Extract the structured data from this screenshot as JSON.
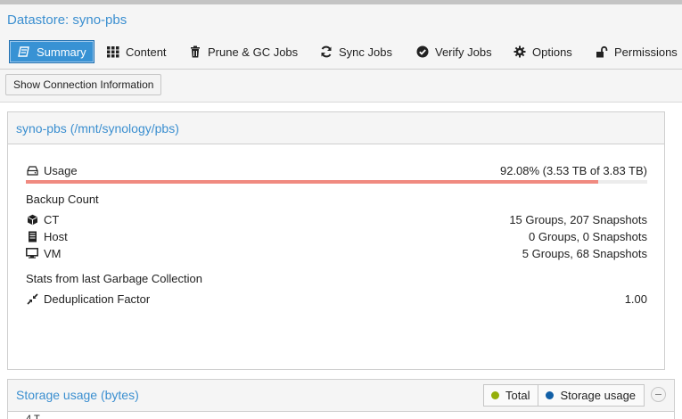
{
  "header": {
    "title": "Datastore: syno-pbs"
  },
  "tabs": [
    {
      "label": "Summary",
      "icon": "book-icon",
      "active": true
    },
    {
      "label": "Content",
      "icon": "grid-icon"
    },
    {
      "label": "Prune & GC Jobs",
      "icon": "trash-icon"
    },
    {
      "label": "Sync Jobs",
      "icon": "refresh-icon"
    },
    {
      "label": "Verify Jobs",
      "icon": "check-circle-icon"
    },
    {
      "label": "Options",
      "icon": "gear-icon"
    },
    {
      "label": "Permissions",
      "icon": "unlock-icon"
    }
  ],
  "toolbar": {
    "connection_button": "Show Connection Information"
  },
  "summary": {
    "title": "syno-pbs (/mnt/synology/pbs)",
    "usage": {
      "label": "Usage",
      "value": "92.08% (3.53 TB of 3.83 TB)",
      "percent": 92.08,
      "bar_color": "#f08a80"
    },
    "backup_count_title": "Backup Count",
    "backups": [
      {
        "label": "CT",
        "icon": "cube-icon",
        "value": "15 Groups, 207 Snapshots"
      },
      {
        "label": "Host",
        "icon": "server-icon",
        "value": "0 Groups, 0 Snapshots"
      },
      {
        "label": "VM",
        "icon": "desktop-icon",
        "value": "5 Groups, 68 Snapshots"
      }
    ],
    "gc_title": "Stats from last Garbage Collection",
    "dedup": {
      "label": "Deduplication Factor",
      "icon": "compress-icon",
      "value": "1.00"
    }
  },
  "storage_chart": {
    "title": "Storage usage (bytes)",
    "legend": [
      {
        "label": "Total",
        "color": "#94ae0a"
      },
      {
        "label": "Storage usage",
        "color": "#115fa6"
      }
    ],
    "top_tick": "4 T"
  }
}
